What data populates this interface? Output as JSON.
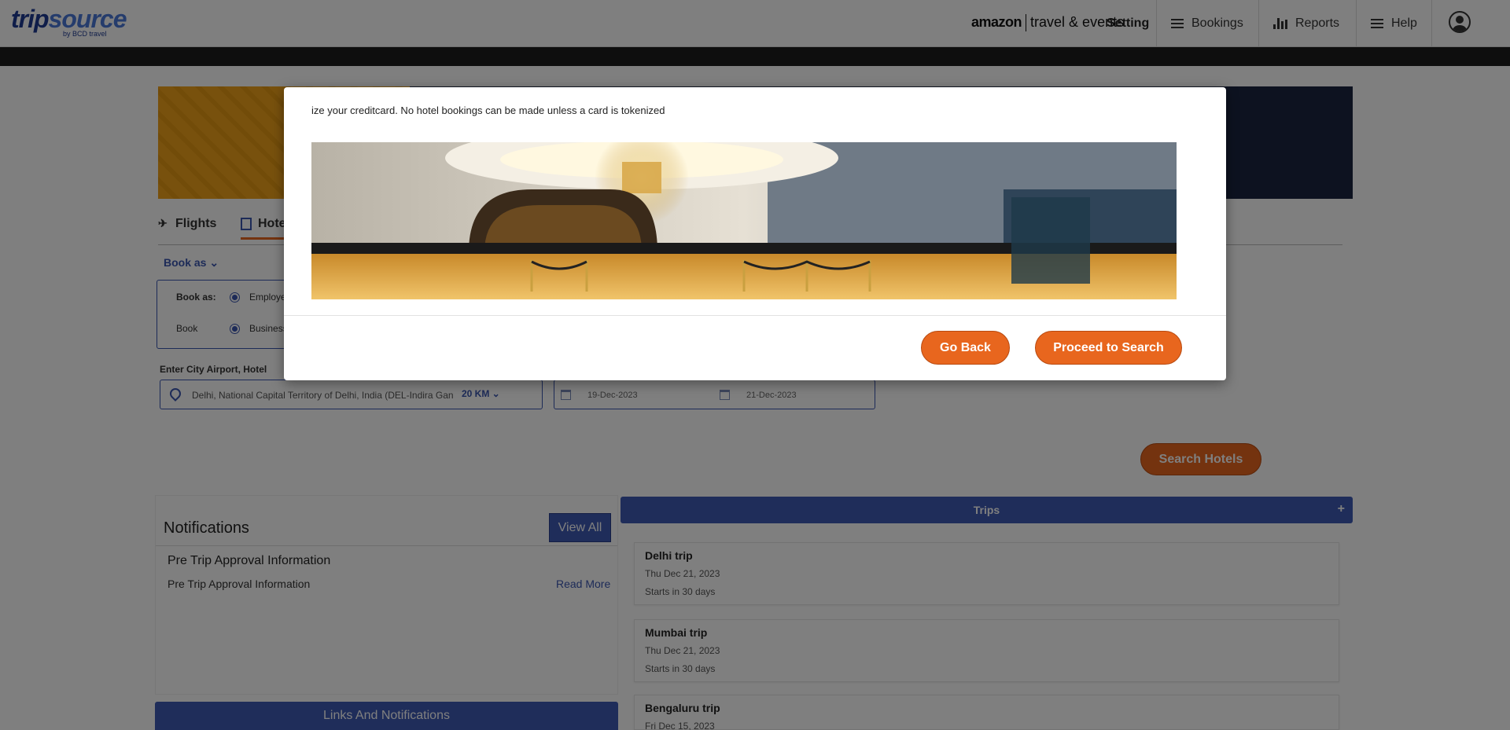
{
  "header": {
    "logo_main_a": "trip",
    "logo_main_b": "source",
    "logo_sub": "by BCD travel",
    "amazon_brand": "amazon",
    "amazon_text": "travel & events",
    "setting": "Setting",
    "nav": [
      {
        "label": "Bookings",
        "icon": "menu-icon"
      },
      {
        "label": "Reports",
        "icon": "bar-chart-icon"
      },
      {
        "label": "Help",
        "icon": "menu-icon"
      }
    ]
  },
  "tabs": {
    "flights": "Flights",
    "hotels": "Hote"
  },
  "booking": {
    "book_as_link": "Book as",
    "book_as_label": "Book as:",
    "book_as_value": "Employee",
    "book_label": "Book",
    "book_value": "Business",
    "city_label": "Enter City Airport, Hotel",
    "city_value": "Delhi, National Capital Territory of Delhi, India (DEL-Indira Gan",
    "radius": "20 KM",
    "checkin": "19-Dec-2023",
    "checkout": "21-Dec-2023",
    "search_button": "Search Hotels"
  },
  "notifications": {
    "title": "Notifications",
    "view_all": "View All",
    "item_title": "Pre Trip Approval Information",
    "item_text": "Pre Trip Approval Information",
    "read_more": "Read More",
    "links_bar": "Links And Notifications"
  },
  "trips": {
    "title": "Trips",
    "add": "+",
    "items": [
      {
        "name": "Delhi trip",
        "date": "Thu Dec 21, 2023",
        "starts": "Starts in 30 days"
      },
      {
        "name": "Mumbai trip",
        "date": "Thu Dec 21, 2023",
        "starts": "Starts in 30 days"
      },
      {
        "name": "Bengaluru trip",
        "date": "Fri Dec 15, 2023",
        "starts": ""
      }
    ]
  },
  "modal": {
    "message": "ize your creditcard.  No hotel bookings can be made unless a card is tokenized",
    "go_back": "Go Back",
    "proceed": "Proceed to Search"
  },
  "colors": {
    "accent_orange": "#e8661e",
    "brand_blue": "#3f5bb5"
  }
}
